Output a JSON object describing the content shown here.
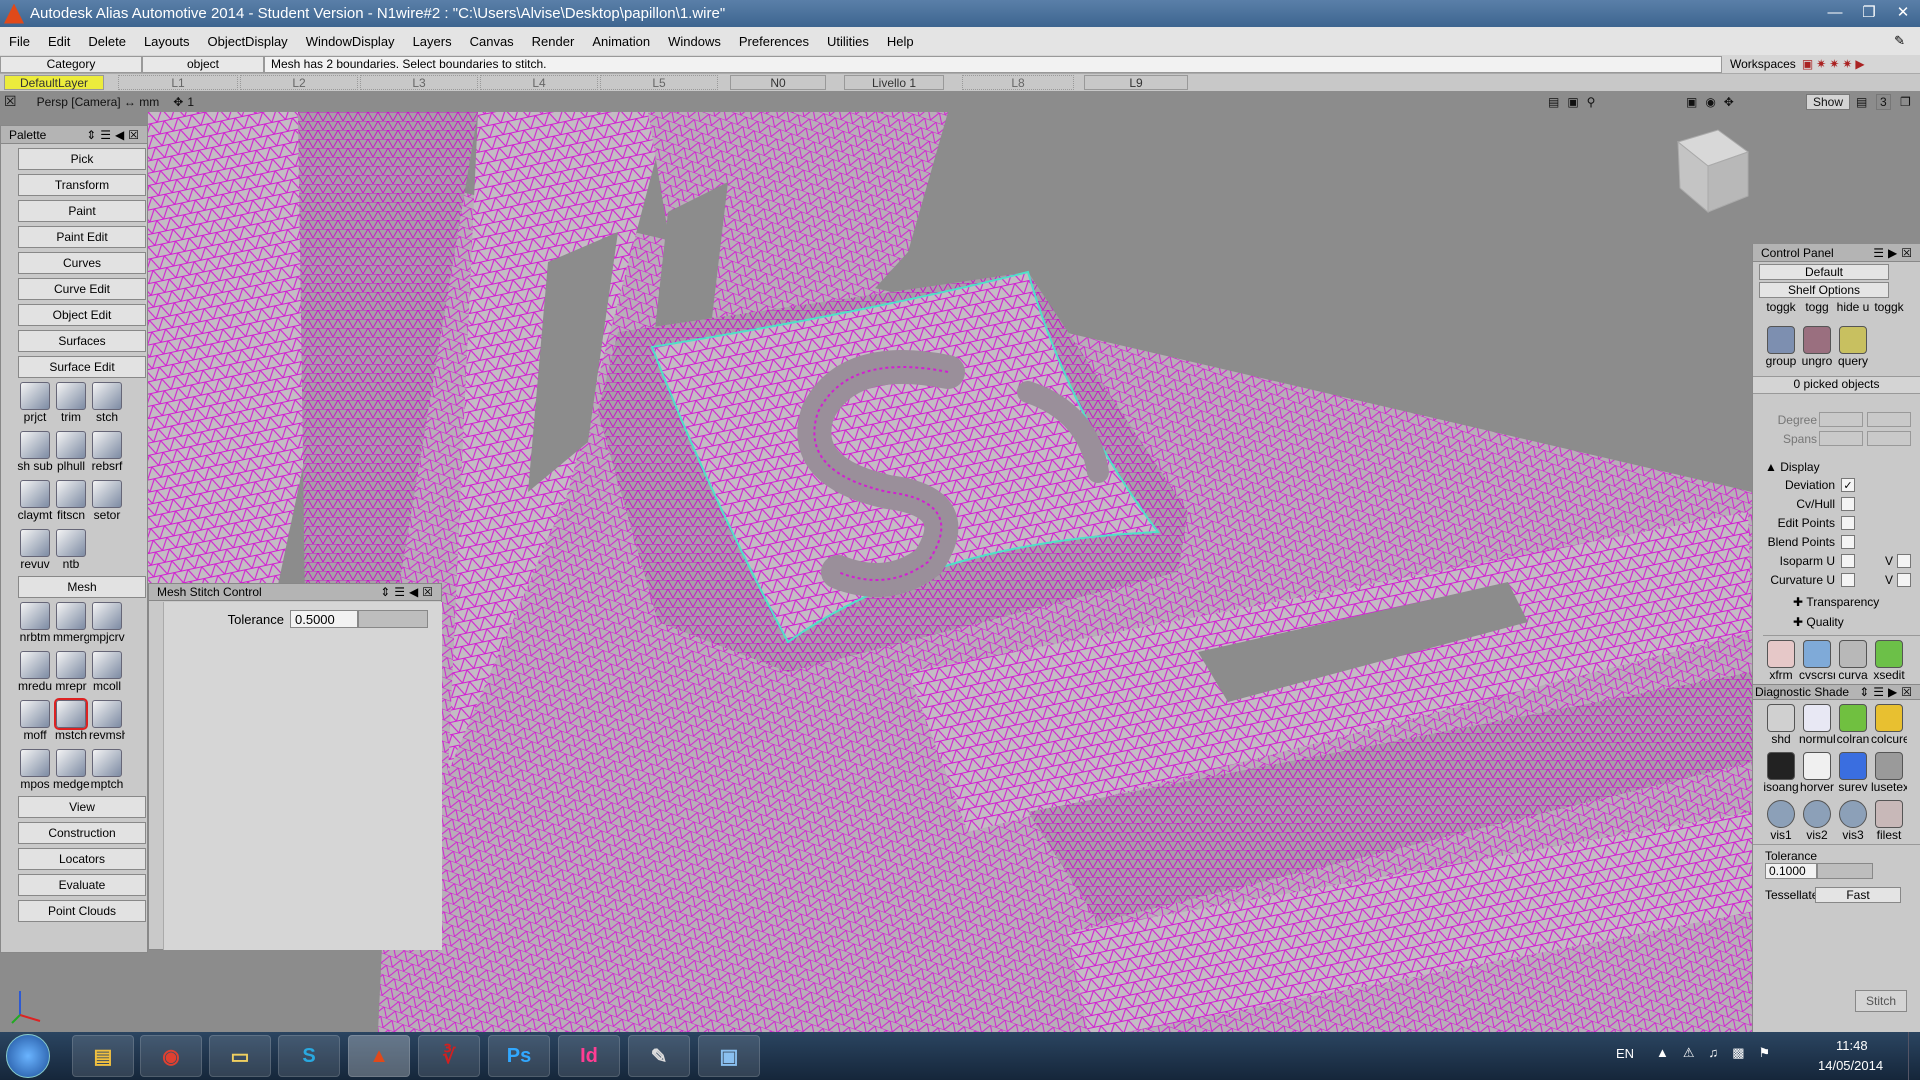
{
  "window": {
    "title": "Autodesk Alias Automotive 2014   - Student Version   - N1wire#2 : \"C:\\Users\\Alvise\\Desktop\\papillon\\1.wire\""
  },
  "menu": [
    "File",
    "Edit",
    "Delete",
    "Layouts",
    "ObjectDisplay",
    "WindowDisplay",
    "Layers",
    "Canvas",
    "Render",
    "Animation",
    "Windows",
    "Preferences",
    "Utilities",
    "Help"
  ],
  "prompt": {
    "category": "Category",
    "object": "object",
    "message": "Mesh has 2 boundaries.  Select boundaries to stitch.",
    "workspaces": "Workspaces"
  },
  "layers": {
    "default": "DefaultLayer",
    "items": [
      "L1",
      "L2",
      "L3",
      "L4",
      "L5",
      "N0",
      "Livello 1",
      "L8",
      "L9"
    ]
  },
  "viewport": {
    "camera": "Persp [Camera] ↔ mm",
    "num": "1",
    "show": "Show",
    "three": "3"
  },
  "palette": {
    "title": "Palette",
    "buttons_top": [
      "Pick",
      "Transform",
      "Paint",
      "Paint Edit",
      "Curves",
      "Curve Edit",
      "Object Edit",
      "Surfaces",
      "Surface Edit"
    ],
    "surface_tools": [
      "prjct",
      "trim",
      "stch",
      "sh sub",
      "plhull",
      "rebsrf",
      "claymt",
      "fitscn",
      "setor",
      "revuv",
      "ntb"
    ],
    "mesh_label": "Mesh",
    "mesh_tools": [
      "nrbtm",
      "mmerge",
      "mpjcrv",
      "mredu",
      "mrepr",
      "mcoll",
      "moff",
      "mstch",
      "revmsh",
      "mpos",
      "medge",
      "mptch"
    ],
    "buttons_bottom": [
      "View",
      "Construction",
      "Locators",
      "Evaluate",
      "Point Clouds"
    ]
  },
  "stitch": {
    "title": "Mesh Stitch Control",
    "tol_label": "Tolerance",
    "tol_value": "0.5000"
  },
  "control": {
    "title": "Control Panel",
    "preset": "Default",
    "shelf": "Shelf Options",
    "shelf_tools": [
      "toggk",
      "togg",
      "hide u",
      "toggk"
    ],
    "shelf_tools2": [
      "group",
      "ungro",
      "query"
    ],
    "picked": "0 picked objects",
    "degree": "Degree",
    "spans": "Spans",
    "display": "Display",
    "options": [
      {
        "label": "Deviation",
        "checked": "✓"
      },
      {
        "label": "Cv/Hull",
        "checked": ""
      },
      {
        "label": "Edit Points",
        "checked": ""
      },
      {
        "label": "Blend Points",
        "checked": ""
      },
      {
        "label": "Isoparm U",
        "checked": ""
      },
      {
        "label": "Curvature U",
        "checked": ""
      }
    ],
    "v_label": "V",
    "transparency": "Transparency",
    "quality": "Quality",
    "eval_tools": [
      "xfrm",
      "cvscrsrf",
      "curva",
      "xsedit"
    ],
    "diag_title": "Diagnostic Shade",
    "diag_tools": [
      "shd",
      "normul",
      "colran",
      "colcurev"
    ],
    "diag_tools2": [
      "isoang",
      "horver",
      "surev",
      "lusetex"
    ],
    "diag_tools3": [
      "vis1",
      "vis2",
      "vis3",
      "filest"
    ],
    "tol_label": "Tolerance",
    "tol_value": "0.1000",
    "tess_label": "Tessellate",
    "tess_value": "Fast",
    "stitch_btn": "Stitch"
  },
  "taskbar": {
    "lang": "EN",
    "time": "11:48",
    "date": "14/05/2014",
    "apps": [
      "explorer",
      "chrome",
      "folder",
      "skype",
      "alias",
      "acrobat",
      "photoshop",
      "indesign",
      "paint",
      "photos"
    ]
  },
  "colors": {
    "mesh": "#d21fd2",
    "surface": "#c2b9c2",
    "boundary": "#4fe0c8",
    "accent": "#2d5d9a"
  }
}
